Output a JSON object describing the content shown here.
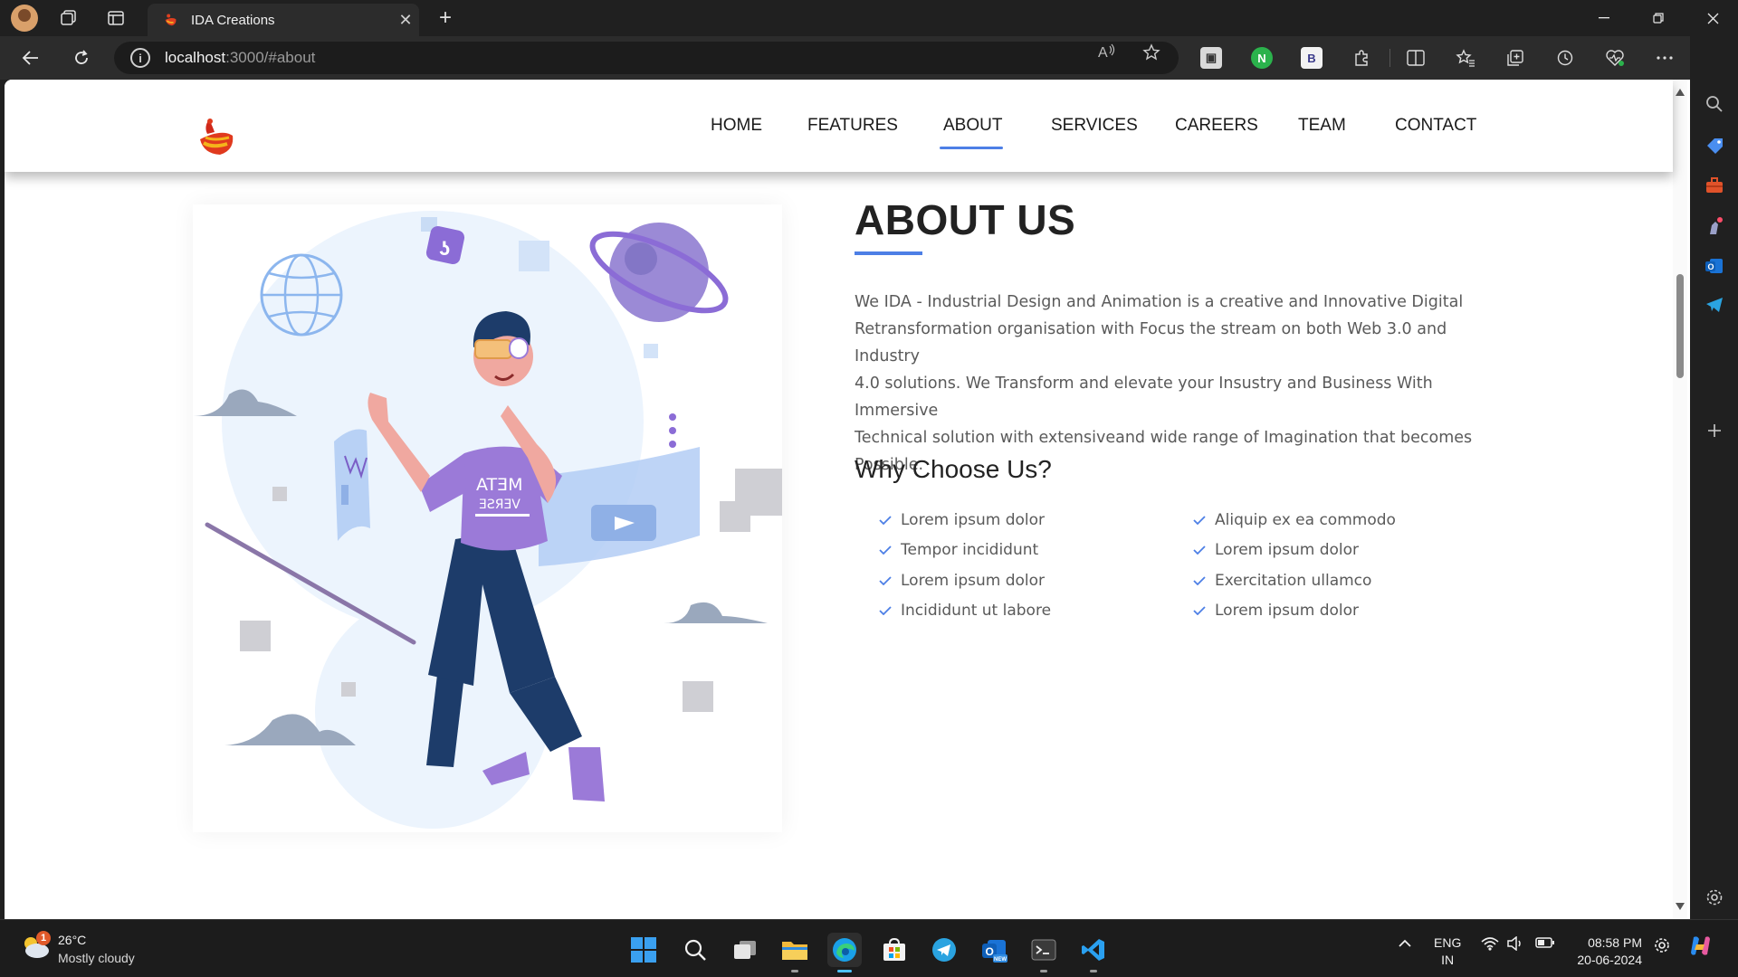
{
  "browser": {
    "tab_title": "IDA Creations",
    "url_host": "localhost",
    "url_path": ":3000/#about",
    "new_tab": "+",
    "close_tab": "✕"
  },
  "site": {
    "nav": [
      "HOME",
      "FEATURES",
      "ABOUT",
      "SERVICES",
      "CAREERS",
      "TEAM",
      "CONTACT"
    ],
    "active_nav": "ABOUT",
    "accent_color": "#4d7fe6"
  },
  "about": {
    "title": "ABOUT US",
    "paragraph_lines": [
      "We IDA - Industrial Design and Animation is a creative and Innovative Digital",
      "Retransformation organisation with Focus the stream on both Web 3.0 and Industry",
      "4.0 solutions. We Transform and elevate your Insustry and Business With Immersive",
      "Technical solution with extensiveand wide range of Imagination that becomes",
      "Possible."
    ],
    "why_title": "Why Choose Us?",
    "features_left": [
      "Lorem ipsum dolor",
      "Tempor incididunt",
      "Lorem ipsum dolor",
      "Incididunt ut labore"
    ],
    "features_right": [
      "Aliquip ex ea commodo",
      "Lorem ipsum dolor",
      "Exercitation ullamco",
      "Lorem ipsum dolor"
    ],
    "illustration_shirt_text_1": "ATƎM",
    "illustration_shirt_text_2": "ƎƧЯƎV"
  },
  "taskbar": {
    "weather_temp": "26°C",
    "weather_desc": "Mostly cloudy",
    "weather_badge": "1",
    "lang_1": "ENG",
    "lang_2": "IN",
    "time": "08:58 PM",
    "date": "20-06-2024"
  },
  "icons": {
    "titlebar": [
      "workspaces-icon",
      "tab-actions-icon"
    ],
    "toolbar": [
      "read-aloud-icon",
      "favorite-star-icon",
      "split-screen-icon",
      "favorites-icon",
      "collections-icon",
      "history-icon",
      "browser-essentials-icon",
      "more-icon"
    ],
    "sidebar": [
      "search-icon",
      "tag-icon",
      "tools-icon",
      "games-icon",
      "outlook-icon",
      "telegram-icon",
      "add-icon",
      "settings-icon"
    ]
  }
}
